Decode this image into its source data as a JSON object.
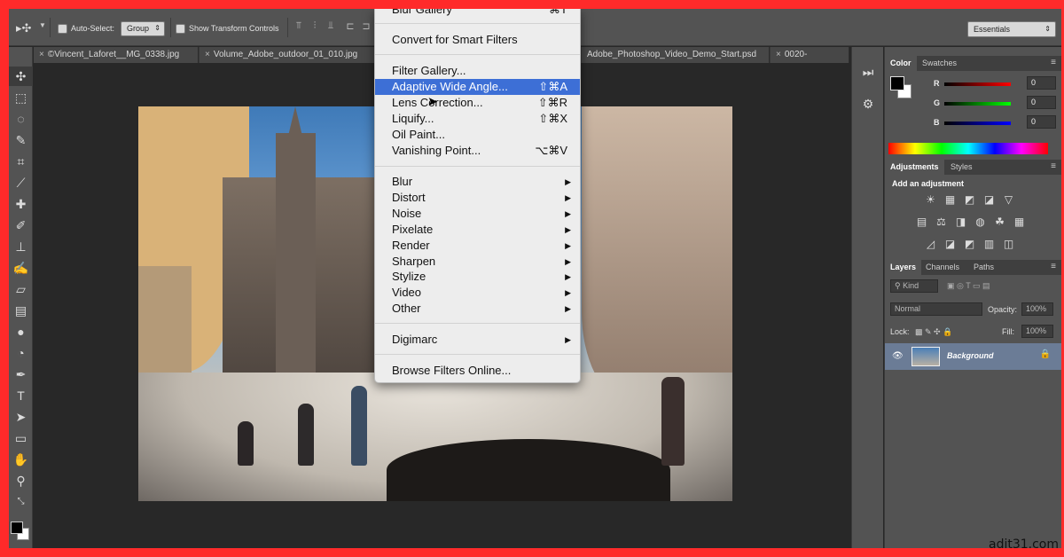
{
  "options_bar": {
    "tool_glyph": "▸✣",
    "auto_select_label": "Auto-Select:",
    "auto_select_target": "Group",
    "show_transform_label": "Show Transform Controls",
    "workspace": "Essentials"
  },
  "document_tabs": [
    {
      "label": "©Vincent_Laforet__MG_0338.jpg"
    },
    {
      "label": "Volume_Adobe_outdoor_01_010.jpg"
    },
    {
      "label": "Adobe_Photoshop_Video_Demo_Start.psd"
    },
    {
      "label": "0020-"
    }
  ],
  "tab_close_glyph": "×",
  "filter_menu": {
    "items": [
      {
        "label": "Blur Gallery",
        "shortcut": "⌘T"
      },
      {
        "label": "Convert for Smart Filters",
        "shortcut": ""
      },
      {
        "label": "Filter Gallery...",
        "shortcut": ""
      },
      {
        "label": "Adaptive Wide Angle...",
        "shortcut": "⇧⌘A",
        "highlighted": true
      },
      {
        "label": "Lens Correction...",
        "shortcut": "⇧⌘R"
      },
      {
        "label": "Liquify...",
        "shortcut": "⇧⌘X"
      },
      {
        "label": "Oil Paint...",
        "shortcut": ""
      },
      {
        "label": "Vanishing Point...",
        "shortcut": "⌥⌘V"
      },
      {
        "label": "Blur",
        "submenu": true
      },
      {
        "label": "Distort",
        "submenu": true
      },
      {
        "label": "Noise",
        "submenu": true
      },
      {
        "label": "Pixelate",
        "submenu": true
      },
      {
        "label": "Render",
        "submenu": true
      },
      {
        "label": "Sharpen",
        "submenu": true
      },
      {
        "label": "Stylize",
        "submenu": true
      },
      {
        "label": "Video",
        "submenu": true
      },
      {
        "label": "Other",
        "submenu": true
      },
      {
        "label": "Digimarc",
        "submenu": true
      },
      {
        "label": "Browse Filters Online...",
        "shortcut": ""
      }
    ],
    "submenu_glyph": "▶"
  },
  "color_panel": {
    "tabs": [
      "Color",
      "Swatches"
    ],
    "channels": [
      {
        "label": "R",
        "value": "0",
        "color": "#ff0000"
      },
      {
        "label": "G",
        "value": "0",
        "color": "#00ff00"
      },
      {
        "label": "B",
        "value": "0",
        "color": "#0000ff"
      }
    ]
  },
  "adjustments_panel": {
    "tabs": [
      "Adjustments",
      "Styles"
    ],
    "add_label": "Add an adjustment",
    "icons": [
      "☀",
      "▦",
      "◩",
      "◪",
      "▽",
      "▤",
      "⚖",
      "◨",
      "◍",
      "☘",
      "▦",
      "◿",
      "◪",
      "◩",
      "▥"
    ]
  },
  "layers_panel": {
    "tabs": [
      "Layers",
      "Channels",
      "Paths"
    ],
    "kind_label": "Kind",
    "blend_mode": "Normal",
    "opacity_label": "Opacity:",
    "opacity_value": "100%",
    "lock_label": "Lock:",
    "fill_label": "Fill:",
    "fill_value": "100%",
    "layer_name": "Background"
  },
  "credit": "adit31.com",
  "colors": {
    "highlight": "#3d6fd6",
    "frame": "#ff2a2a"
  }
}
